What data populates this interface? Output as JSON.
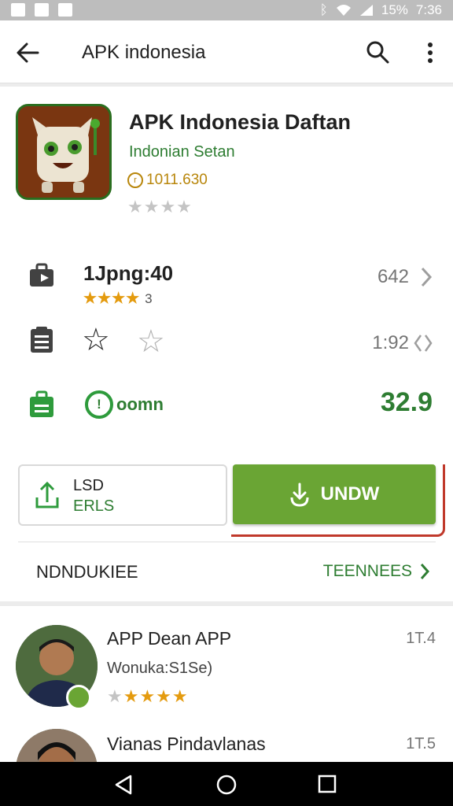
{
  "status_bar": {
    "battery_text": "15%",
    "time": "7:36"
  },
  "search": {
    "query": "APK indonesia"
  },
  "app": {
    "title": "APK Indonesia Daftan",
    "developer": "Indonian Setan",
    "meta": "1011.630",
    "stars": "★★★★"
  },
  "info_rows": {
    "row1": {
      "label": "1Jpng:40",
      "stars": "★★★★",
      "rating_count": "3",
      "value": "642"
    },
    "row2": {
      "value": "1:92"
    },
    "row3": {
      "badge": "oomn",
      "price": "32.9"
    }
  },
  "buttons": {
    "secondary_line1": "LSD",
    "secondary_line2": "ERLS",
    "install_label": "UNDW"
  },
  "section": {
    "title": "NDNDUKIEE",
    "link": "TEENNEES"
  },
  "reviews": [
    {
      "title": "APP Dean APP",
      "subtitle": "Wonuka:S1Se)",
      "date": "1T.4",
      "stars": "★★★★"
    },
    {
      "title": "Vianas Pindavlanas",
      "date": "1T.5"
    }
  ],
  "colors": {
    "accent_green": "#6aa534",
    "text_green": "#2e7d32",
    "highlight_red": "#c0392b",
    "star_gold": "#e49b0f"
  }
}
